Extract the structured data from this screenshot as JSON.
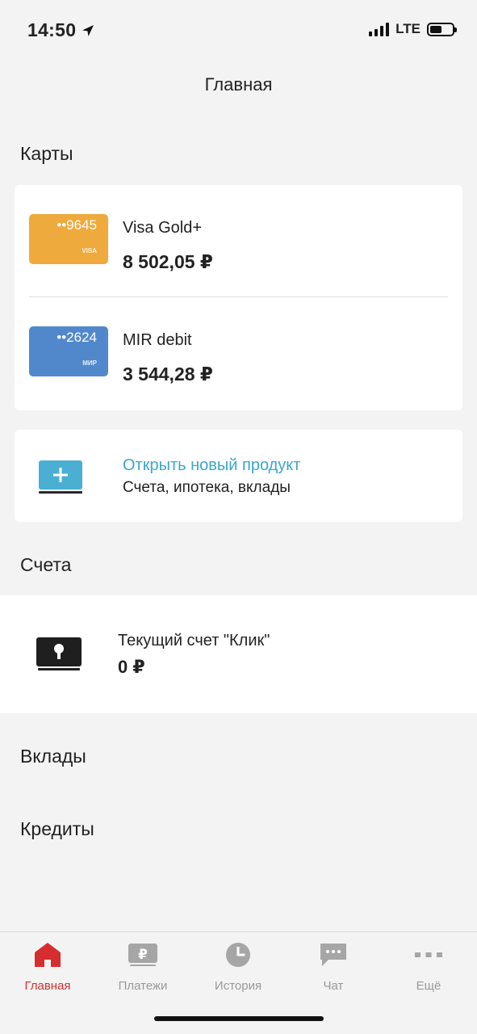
{
  "status_bar": {
    "time": "14:50",
    "network": "LTE",
    "battery_level": 0.55
  },
  "header": {
    "title": "Главная"
  },
  "sections": {
    "cards": "Карты",
    "accounts": "Счета",
    "deposits": "Вклады",
    "credits": "Кредиты"
  },
  "cards": [
    {
      "number": "••9645",
      "brand": "VISA",
      "name": "Visa Gold+",
      "balance": "8 502,05 ₽",
      "color": "#eeaa3c"
    },
    {
      "number": "••2624",
      "brand": "МИР",
      "name": "MIR debit",
      "balance": "3 544,28 ₽",
      "color": "#5188cb"
    }
  ],
  "new_product": {
    "title": "Открыть новый продукт",
    "subtitle": "Счета, ипотека, вклады",
    "accent_color": "#3aa7c9"
  },
  "account": {
    "name": "Текущий счет \"Клик\"",
    "balance": "0 ₽"
  },
  "tabs": [
    {
      "label": "Главная",
      "icon": "home-icon",
      "active": true
    },
    {
      "label": "Платежи",
      "icon": "ruble-icon",
      "active": false
    },
    {
      "label": "История",
      "icon": "clock-icon",
      "active": false
    },
    {
      "label": "Чат",
      "icon": "chat-icon",
      "active": false
    },
    {
      "label": "Ещё",
      "icon": "more-icon",
      "active": false
    }
  ],
  "colors": {
    "active_tab": "#d62e2e",
    "inactive_tab": "#999999",
    "background": "#f3f3f3"
  }
}
